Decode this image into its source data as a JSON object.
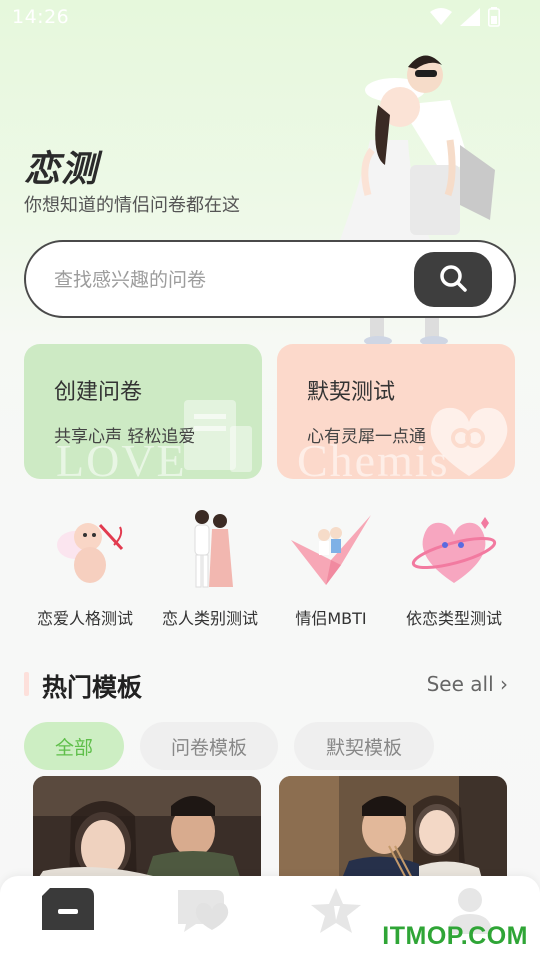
{
  "status_bar": {
    "time": "14:26",
    "icons": [
      "wifi-icon",
      "signal-icon",
      "battery-icon"
    ]
  },
  "hero": {
    "title": "恋测",
    "subtitle": "你想知道的情侣问卷都在这"
  },
  "search": {
    "placeholder": "查找感兴趣的问卷",
    "button_icon": "search-icon"
  },
  "cards": [
    {
      "title": "创建问卷",
      "subtitle": "共享心声 轻松追爱",
      "watermark": "LOVE"
    },
    {
      "title": "默契测试",
      "subtitle": "心有灵犀一点通",
      "watermark": "Chemis"
    }
  ],
  "categories": [
    {
      "label": "恋爱人格测试",
      "icon": "cupid-icon"
    },
    {
      "label": "恋人类别测试",
      "icon": "couple-icon"
    },
    {
      "label": "情侣MBTI",
      "icon": "paper-crane-icon"
    },
    {
      "label": "依恋类型测试",
      "icon": "heart-planet-icon"
    }
  ],
  "section": {
    "title": "热门模板",
    "see_all": "See all ›"
  },
  "filter_tabs": [
    {
      "label": "全部",
      "active": true
    },
    {
      "label": "问卷模板",
      "active": false
    },
    {
      "label": "默契模板",
      "active": false
    }
  ],
  "nav": [
    {
      "icon": "home-icon",
      "active": true
    },
    {
      "icon": "heart-chat-icon",
      "active": false
    },
    {
      "icon": "star-icon",
      "active": false
    },
    {
      "icon": "profile-icon",
      "active": false
    }
  ],
  "watermark_site": "ITMOP.COM",
  "colors": {
    "accent_green": "#5fbf4a",
    "tab_active_bg": "#cdeec3",
    "card_green": "#cdeac4",
    "card_peach": "#fcd9cb",
    "dark_button": "#3e3e3e"
  }
}
